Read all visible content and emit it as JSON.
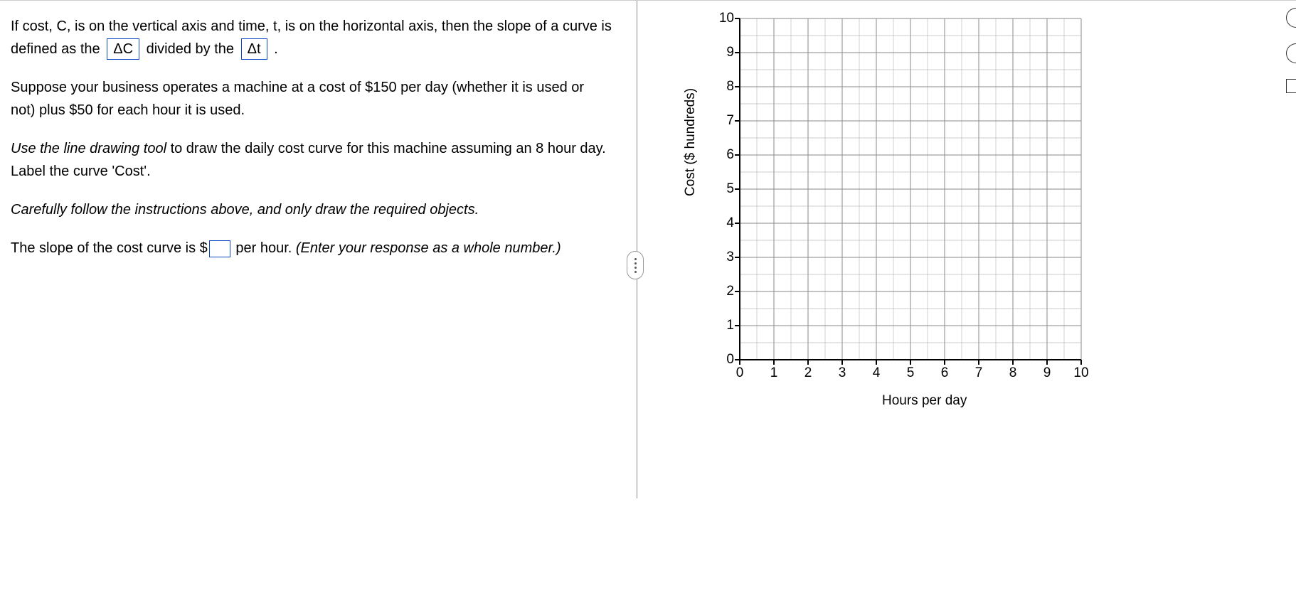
{
  "question": {
    "p1_a": "If cost, C, is on the vertical axis and time, t, is on the horizontal axis, then the slope of a curve is defined as the ",
    "ans1": "ΔC",
    "p1_b": " divided by the ",
    "ans2": "Δt",
    "p1_c": " .",
    "p2": "Suppose your business operates a machine at a cost of $150 per day (whether it is used or not) plus $50 for each hour it is used.",
    "p3_a": "Use the line drawing tool",
    "p3_b": " to draw the daily cost curve for this machine assuming an 8 hour day. Label the curve 'Cost'.",
    "p4": "Carefully follow the instructions above, and only draw the required objects.",
    "p5_a": "The slope of the cost curve is $",
    "p5_b": " per hour. ",
    "p5_c": "(Enter your response as a whole number.)"
  },
  "chart_data": {
    "type": "scatter",
    "title": "",
    "xlabel": "Hours per day",
    "ylabel": "Cost ($ hundreds)",
    "xlim": [
      0,
      10
    ],
    "ylim": [
      0,
      10
    ],
    "xticks": [
      0,
      1,
      2,
      3,
      4,
      5,
      6,
      7,
      8,
      9,
      10
    ],
    "yticks": [
      0,
      1,
      2,
      3,
      4,
      5,
      6,
      7,
      8,
      9,
      10
    ],
    "series": []
  }
}
